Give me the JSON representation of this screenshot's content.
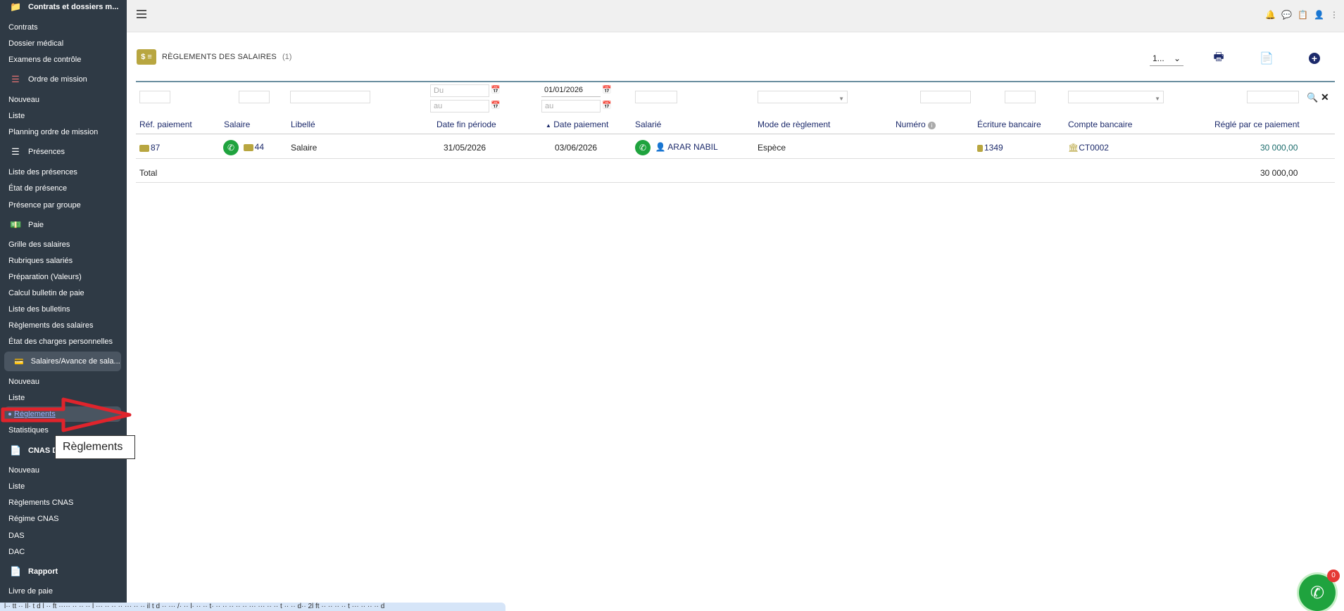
{
  "sidebar": {
    "section_contrats": "Contrats et dossiers m...",
    "contrats": "Contrats",
    "dossier_medical": "Dossier médical",
    "examens": "Examens de contrôle",
    "ordre_mission": "Ordre de mission",
    "om_nouveau": "Nouveau",
    "om_liste": "Liste",
    "om_planning": "Planning ordre de mission",
    "presences": "Présences",
    "liste_presences": "Liste des présences",
    "etat_presence": "État de présence",
    "presence_groupe": "Présence par groupe",
    "paie": "Paie",
    "grille_salaires": "Grille des salaires",
    "rubriques": "Rubriques salariés",
    "preparation": "Préparation (Valeurs)",
    "calcul_bulletin": "Calcul bulletin de paie",
    "liste_bulletins": "Liste des bulletins",
    "reglements_salaires": "Règlements des salaires",
    "etat_charges": "État des charges personnelles",
    "salaires_avance": "Salaires/Avance de sala...",
    "sa_nouveau": "Nouveau",
    "sa_liste": "Liste",
    "sa_reglements": "Règlements",
    "sa_statistiques": "Statistiques",
    "cnas": "CNAS D",
    "cnas_nouveau": "Nouveau",
    "cnas_liste": "Liste",
    "cnas_reglements": "Règlements CNAS",
    "regime_cnas": "Régime CNAS",
    "das": "DAS",
    "dac": "DAC",
    "rapport": "Rapport",
    "livre_paie": "Livre de paie"
  },
  "tooltip": "Règlements",
  "page": {
    "icon_text": "$",
    "title": "RÈGLEMENTS DES SALAIRES",
    "count": "(1)",
    "pager": "1..."
  },
  "filters": {
    "date_fin_du": "Du",
    "date_fin_au": "au",
    "date_paiement_du": "01/01/2026",
    "date_paiement_au": "au"
  },
  "columns": {
    "ref": "Réf. paiement",
    "salaire": "Salaire",
    "libelle": "Libellé",
    "date_fin": "Date fin période",
    "date_paiement": "Date paiement",
    "salarie": "Salarié",
    "mode": "Mode de règlement",
    "numero": "Numéro",
    "ecriture": "Écriture bancaire",
    "compte": "Compte bancaire",
    "regle": "Réglé par ce paiement"
  },
  "rows": [
    {
      "ref": "87",
      "salaire": "44",
      "libelle": "Salaire",
      "date_fin": "31/05/2026",
      "date_paiement": "03/06/2026",
      "salarie": "ARAR NABIL",
      "mode": "Espèce",
      "numero": "",
      "ecriture": "1349",
      "compte": "CT0002",
      "regle": "30 000,00"
    }
  ],
  "total": {
    "label": "Total",
    "value": "30 000,00"
  },
  "whatsapp_badge": "0",
  "bottom_text": "l·· tt  ·· Il· t d l ·· ft ····· ·· ·· ·· l ··· ·· ·· ·· ··· ·· ·· il t d ·· ··· /· ·· l· ·· ·· t· ·· ·· ·· ·· ·· ··· ··· ·· ·· t ·· ·· d·· 2l ft ·· ·· ·· ·· t ··· ·· ·· ·· d"
}
